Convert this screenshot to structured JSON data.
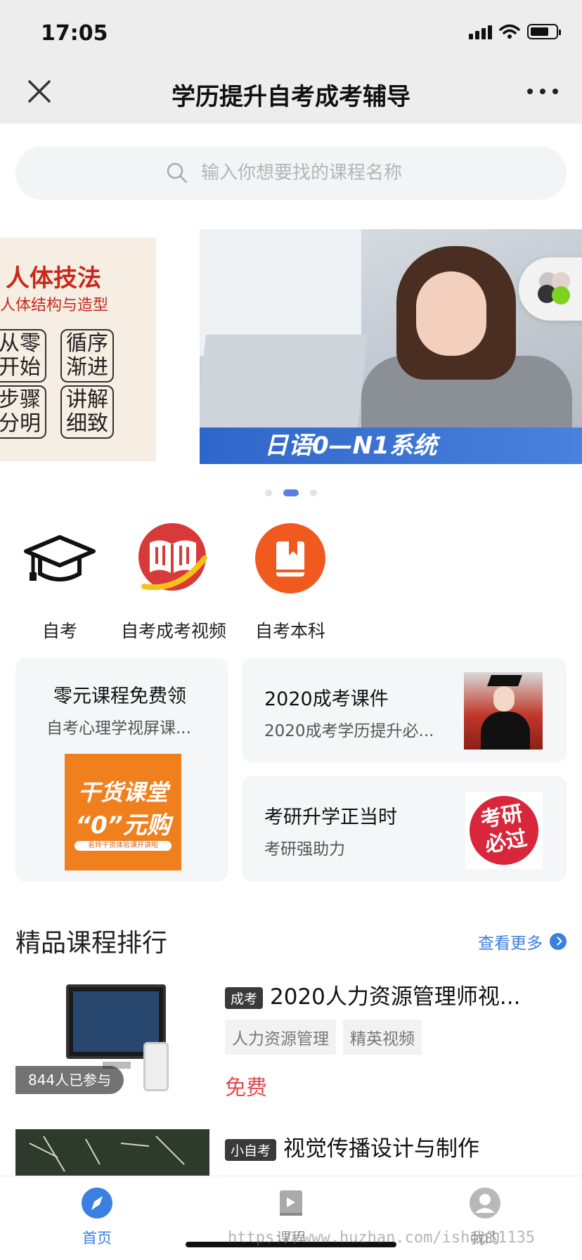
{
  "status_bar": {
    "time": "17:05"
  },
  "nav": {
    "title": "学历提升自考成考辅导"
  },
  "search": {
    "placeholder": "输入你想要找的课程名称"
  },
  "carousel": {
    "slide_left": {
      "title": "人体技法",
      "subtitle": "人体结构与造型",
      "boxes": [
        "从零",
        "开始",
        "循序",
        "渐进",
        "步骤",
        "分明",
        "讲解",
        "细致"
      ]
    },
    "slide_main": {
      "banner_text": "日语0—N1系统"
    },
    "active_index": 1,
    "total": 3
  },
  "categories": [
    {
      "label": "自考",
      "icon": "graduation-cap-icon"
    },
    {
      "label": "自考成考视频",
      "icon": "open-book-icon"
    },
    {
      "label": "自考本科",
      "icon": "bookmark-book-icon"
    }
  ],
  "promos": {
    "left": {
      "title": "零元课程免费领",
      "subtitle": "自考心理学视屏课...",
      "image_text": [
        "干货课堂",
        "“0”元购",
        "名师干货体验课开讲啦"
      ]
    },
    "right_top": {
      "title": "2020成考课件",
      "subtitle": "2020成考学历提升必..."
    },
    "right_bottom": {
      "title": "考研升学正当时",
      "subtitle": "考研强助力",
      "image_text": [
        "考研",
        "必过"
      ]
    }
  },
  "ranking": {
    "title": "精品课程排行",
    "see_more": "查看更多",
    "courses": [
      {
        "tag": "成考",
        "title": "2020人力资源管理师视...",
        "chips": [
          "人力资源管理",
          "精英视频"
        ],
        "price": "免费",
        "participants": "844人已参与"
      },
      {
        "tag": "小自考",
        "title": "视觉传播设计与制作"
      }
    ]
  },
  "tabbar": {
    "items": [
      {
        "label": "首页",
        "icon": "compass-icon",
        "active": true
      },
      {
        "label": "课程",
        "icon": "course-book-icon",
        "active": false
      },
      {
        "label": "我的",
        "icon": "user-icon",
        "active": false
      }
    ]
  },
  "watermark": "https://www.huzhan.com/ishop11135",
  "colors": {
    "accent": "#3b7fe0",
    "price": "#e5484d",
    "orange": "#f0801e",
    "red": "#d8263b"
  }
}
